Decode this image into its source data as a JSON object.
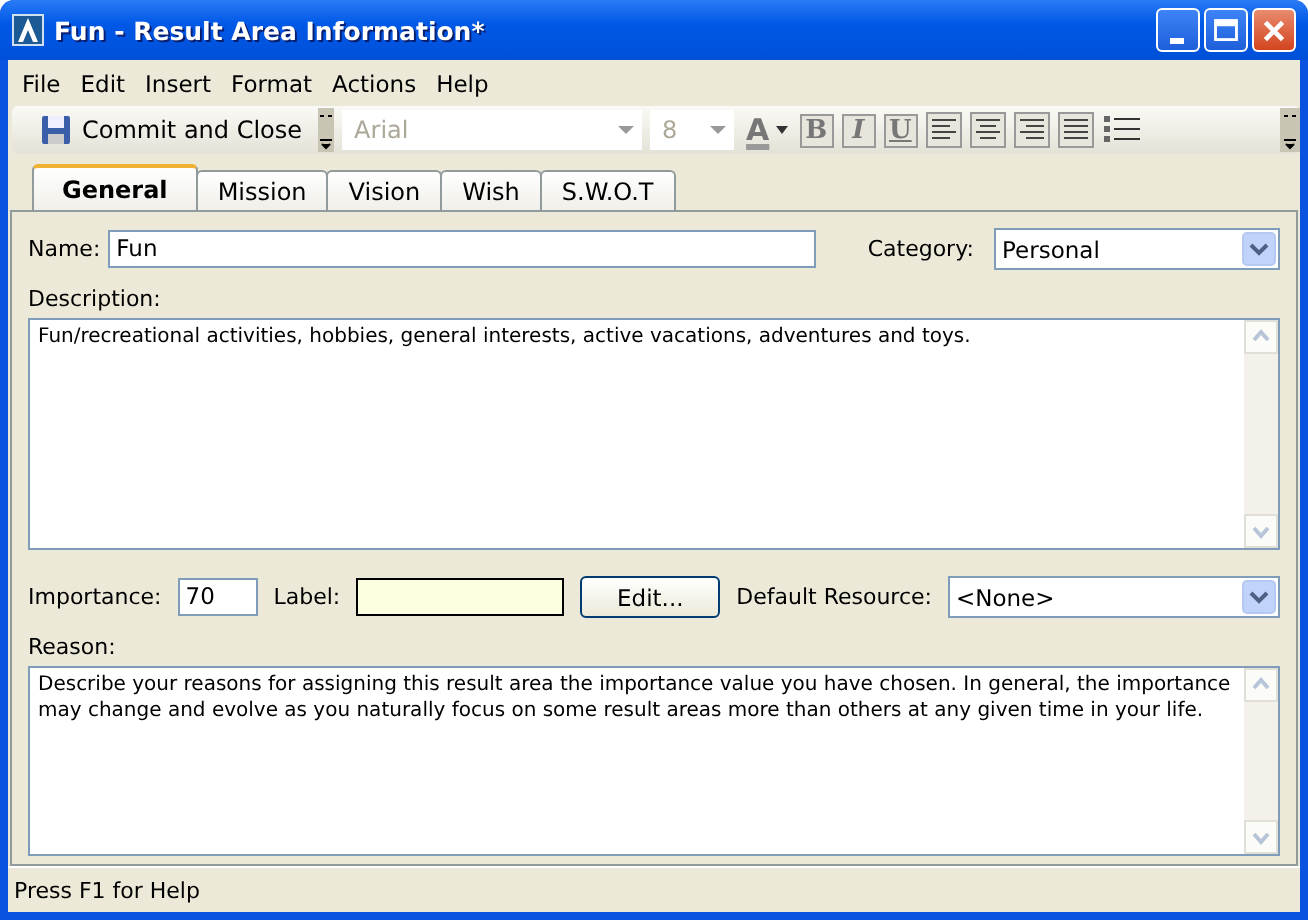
{
  "window": {
    "title": "Fun - Result Area Information*"
  },
  "menu": [
    "File",
    "Edit",
    "Insert",
    "Format",
    "Actions",
    "Help"
  ],
  "toolbar": {
    "commit_button": "Commit and Close",
    "font_field": {
      "value": "Arial",
      "disabled": true
    },
    "size_field": {
      "value": "8",
      "disabled": true
    },
    "font_color": "A",
    "style_buttons": [
      "B",
      "I",
      "U"
    ]
  },
  "tabs": [
    {
      "label": "General",
      "selected": true
    },
    {
      "label": "Mission",
      "selected": false
    },
    {
      "label": "Vision",
      "selected": false
    },
    {
      "label": "Wish",
      "selected": false
    },
    {
      "label": "S.W.O.T",
      "selected": false
    }
  ],
  "form": {
    "name": {
      "label": "Name:",
      "value": "Fun"
    },
    "category": {
      "label": "Category:",
      "value": "Personal"
    },
    "description": {
      "label": "Description:",
      "value": "Fun/recreational activities, hobbies, general interests, active vacations, adventures and toys."
    },
    "importance": {
      "label": "Importance:",
      "value": "70"
    },
    "label_field": {
      "label": "Label:"
    },
    "edit_button": "Edit...",
    "default_resource": {
      "label": "Default Resource:",
      "value": "<None>"
    },
    "reason": {
      "label": "Reason:",
      "value": "Describe your reasons for assigning this result area the importance value you have chosen. In general, the importance may change and evolve as you naturally focus on some result areas more than others at any given time in your life."
    }
  },
  "status_bar": "Press F1 for Help"
}
